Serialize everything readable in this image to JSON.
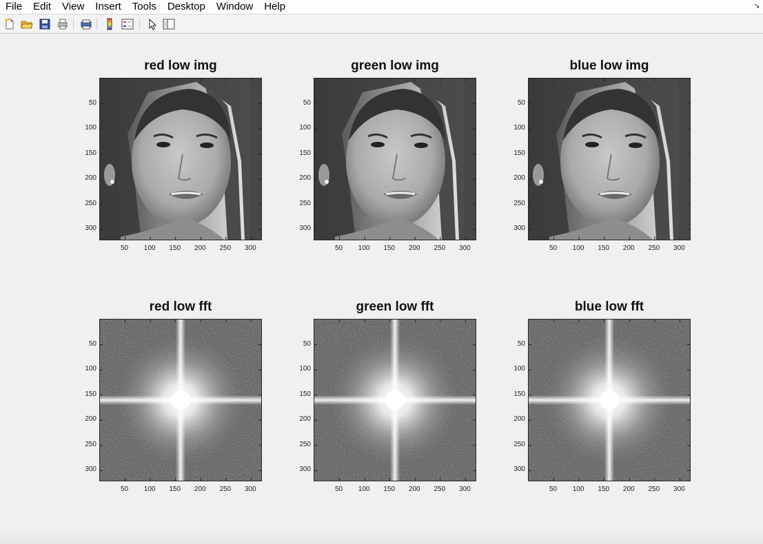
{
  "menu": [
    "File",
    "Edit",
    "View",
    "Insert",
    "Tools",
    "Desktop",
    "Window",
    "Help"
  ],
  "toolbar_icons": [
    "new-figure-icon",
    "open-file-icon",
    "save-icon",
    "print-icon",
    "print-preview-icon",
    "colorbar-icon",
    "legend-icon",
    "pointer-icon",
    "property-editor-icon"
  ],
  "y_ticks": [
    "50",
    "100",
    "150",
    "200",
    "250",
    "300"
  ],
  "x_ticks": [
    "50",
    "100",
    "150",
    "200",
    "250",
    "300"
  ],
  "subplots": [
    {
      "title": "red low img",
      "kind": "image"
    },
    {
      "title": "green low img",
      "kind": "image"
    },
    {
      "title": "blue low img",
      "kind": "image"
    },
    {
      "title": "red low fft",
      "kind": "fft"
    },
    {
      "title": "green low fft",
      "kind": "fft"
    },
    {
      "title": "blue low fft",
      "kind": "fft"
    }
  ]
}
